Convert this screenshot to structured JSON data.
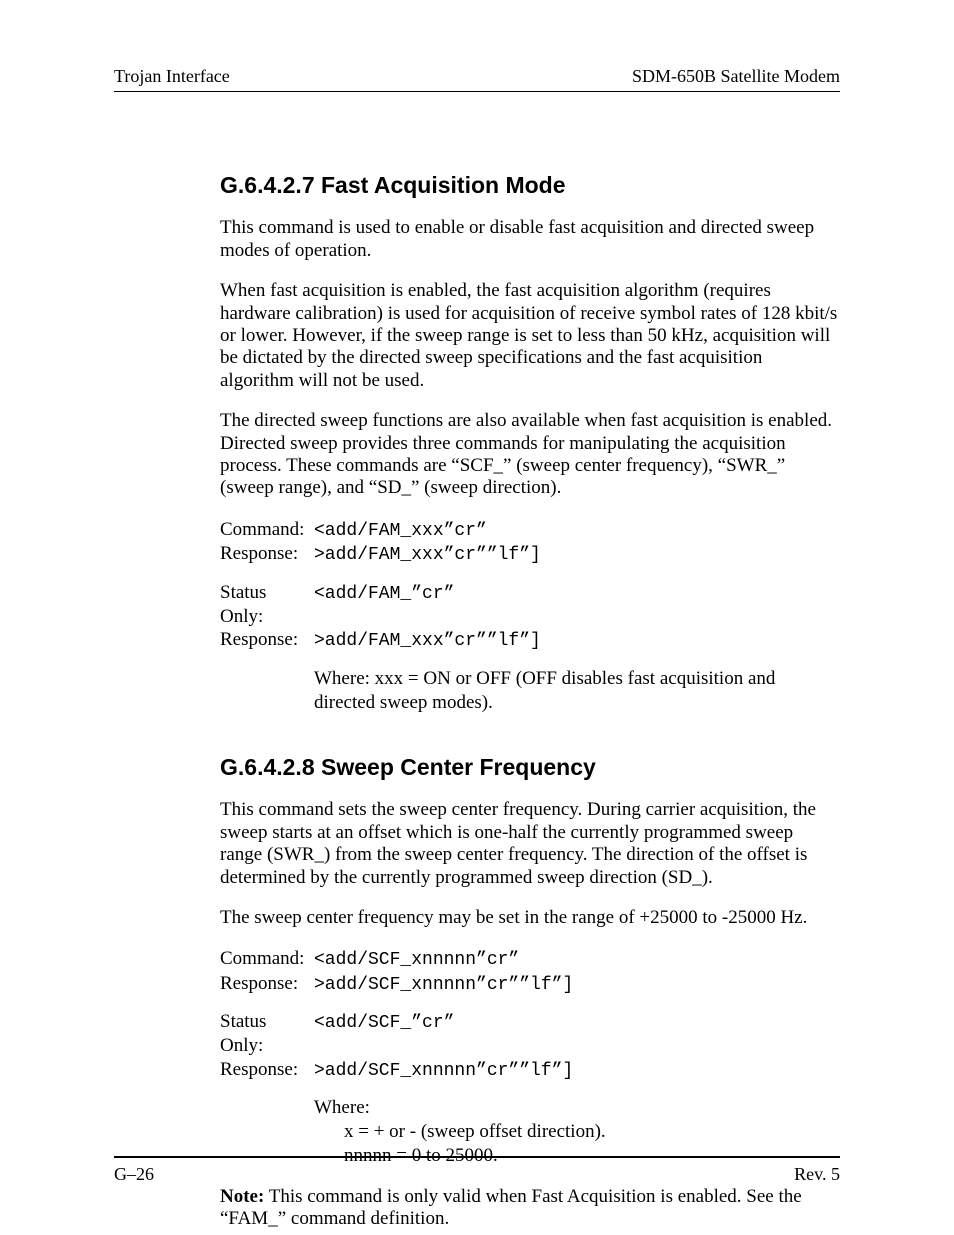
{
  "header": {
    "left": "Trojan Interface",
    "right": "SDM-650B Satellite Modem"
  },
  "section1": {
    "heading": "G.6.4.2.7  Fast Acquisition Mode",
    "p1": "This command is used to enable or disable fast acquisition and directed sweep modes of operation.",
    "p2": "When fast acquisition is enabled, the fast acquisition algorithm (requires hardware calibration) is used for acquisition of receive symbol rates of 128 kbit/s or lower. However, if the sweep range is set to less than 50 kHz, acquisition will be dictated by the directed sweep specifications and the fast acquisition algorithm will not be used.",
    "p3": "The directed sweep functions are also available when fast acquisition is enabled. Directed sweep provides three commands for manipulating the acquisition process. These commands are “SCF_” (sweep center frequency), “SWR_” (sweep range), and “SD_” (sweep direction).",
    "cmd1": {
      "l1": "Command:",
      "c1": "<add/FAM_xxx”cr”",
      "l2": "Response:",
      "c2": ">add/FAM_xxx”cr””lf”]"
    },
    "cmd2": {
      "l1": "Status Only:",
      "c1": "<add/FAM_”cr”",
      "l2": "Response:",
      "c2": ">add/FAM_xxx”cr””lf”]"
    },
    "where": "Where: xxx = ON or OFF (OFF disables fast acquisition and directed sweep modes)."
  },
  "section2": {
    "heading": "G.6.4.2.8  Sweep Center Frequency",
    "p1": "This command sets the sweep center frequency. During carrier acquisition, the sweep starts at an offset which is one-half the currently programmed sweep range (SWR_) from the sweep center frequency. The direction of the offset is determined by the currently programmed sweep direction (SD_).",
    "p2": "The sweep center frequency may be set in the range of +25000 to -25000 Hz.",
    "cmd1": {
      "l1": "Command:",
      "c1": "<add/SCF_xnnnnn”cr”",
      "l2": "Response:",
      "c2": ">add/SCF_xnnnnn”cr””lf”]"
    },
    "cmd2": {
      "l1": "Status Only:",
      "c1": "<add/SCF_”cr”",
      "l2": "Response:",
      "c2": ">add/SCF_xnnnnn”cr””lf”]"
    },
    "where_label": "Where:",
    "where_l1": "x = + or - (sweep offset direction).",
    "where_l2": "nnnnn = 0 to 25000.",
    "note_label": "Note:",
    "note_text": " This command is only valid when Fast Acquisition is enabled. See the “FAM_” command definition."
  },
  "footer": {
    "left": "G–26",
    "right": "Rev. 5"
  }
}
